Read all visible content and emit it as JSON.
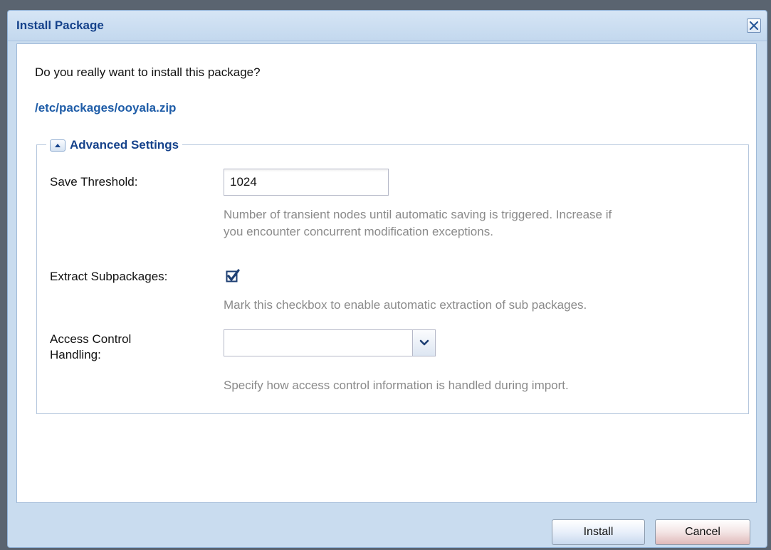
{
  "dialog": {
    "title": "Install Package",
    "close_icon": "close-icon"
  },
  "content": {
    "question": "Do you really want to install this package?",
    "package_path": "/etc/packages/ooyala.zip"
  },
  "advanced": {
    "legend": "Advanced Settings",
    "collapse_icon": "chevron-up-icon",
    "save_threshold": {
      "label": "Save Threshold:",
      "value": "1024",
      "hint_line1": "Number of transient nodes until automatic saving is triggered. Increase if",
      "hint_line2": "you encounter concurrent modification exceptions."
    },
    "extract_subpackages": {
      "label": "Extract Subpackages:",
      "checked": true,
      "hint": "Mark this checkbox to enable automatic extraction of sub packages."
    },
    "access_control": {
      "label_line1": "Access Control",
      "label_line2": "Handling:",
      "value": "",
      "dropdown_icon": "chevron-down-icon",
      "hint": "Specify how access control information is handled during import."
    }
  },
  "buttons": {
    "install": "Install",
    "cancel": "Cancel"
  },
  "colors": {
    "title_text": "#15428b",
    "path_text": "#1f5da8",
    "hint_text": "#8a8a8a",
    "dialog_frame": "#c9dcef"
  }
}
